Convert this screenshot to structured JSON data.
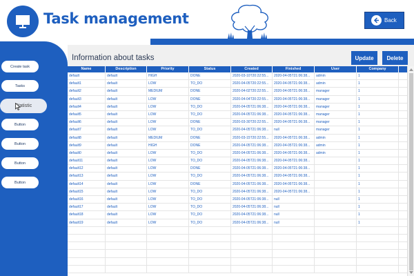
{
  "header": {
    "title": "Task management",
    "logo_icon": "presentation-board-icon",
    "back_label": "Back",
    "back_icon": "back-arrow-icon"
  },
  "sidebar": {
    "items": [
      {
        "label": "Create task"
      },
      {
        "label": "Tasks"
      },
      {
        "label": "Statistic",
        "active": true
      },
      {
        "label": "Button"
      },
      {
        "label": "Button"
      },
      {
        "label": "Button"
      },
      {
        "label": "Button"
      }
    ]
  },
  "main": {
    "title": "Information about tasks",
    "update_label": "Update",
    "delete_label": "Delete"
  },
  "table": {
    "columns": [
      "Name",
      "Description",
      "Priority",
      "Status",
      "Created",
      "Finished",
      "User",
      "Company"
    ],
    "rows": [
      [
        "default",
        "default",
        "HIGH",
        "DONE",
        "2020-03-10T20:22:55...",
        "2020-04-05T21:06:38...",
        "admin",
        "1"
      ],
      [
        "default1",
        "default",
        "LOW",
        "TO_DO",
        "2020-04-05T20:22:55...",
        "2020-04-05T21:06:38...",
        "admin",
        "1"
      ],
      [
        "default2",
        "default",
        "MEDIUM",
        "DONE",
        "2020-04-02T20:22:55...",
        "2020-04-05T21:06:38...",
        "manager",
        "1"
      ],
      [
        "default3",
        "default",
        "LOW",
        "DONE",
        "2020-04-04T20:22:55...",
        "2020-04-05T21:06:38...",
        "manager",
        "1"
      ],
      [
        "default4",
        "default",
        "LOW",
        "TO_DO",
        "2020-04-05T21:06:38...",
        "2020-04-05T21:06:38...",
        "manager",
        "1"
      ],
      [
        "default5",
        "default",
        "LOW",
        "TO_DO",
        "2020-04-05T21:06:38...",
        "2020-04-05T21:06:38...",
        "manager",
        "1"
      ],
      [
        "default6",
        "default",
        "LOW",
        "DONE",
        "2020-03-30T20:22:55...",
        "2020-04-05T21:06:38...",
        "manager",
        "1"
      ],
      [
        "default7",
        "default",
        "LOW",
        "TO_DO",
        "2020-04-05T21:06:38...",
        "null",
        "manager",
        "1"
      ],
      [
        "default8",
        "default",
        "MEDIUM",
        "DONE",
        "2020-03-15T20:22:55...",
        "2020-04-05T21:06:38...",
        "admin",
        "1"
      ],
      [
        "default9",
        "default",
        "HIGH",
        "DONE",
        "2020-04-05T21:06:38...",
        "2020-04-05T21:06:38...",
        "admin",
        "1"
      ],
      [
        "default0",
        "default",
        "LOW",
        "TO_DO",
        "2020-04-05T21:06:38...",
        "2020-04-05T21:06:38...",
        "admin",
        "1"
      ],
      [
        "default11",
        "default",
        "LOW",
        "TO_DO",
        "2020-04-05T21:06:38...",
        "2020-04-05T21:06:38...",
        "",
        "1"
      ],
      [
        "default12",
        "default",
        "LOW",
        "DONE",
        "2020-04-05T21:06:38...",
        "2020-04-05T21:06:38...",
        "",
        "1"
      ],
      [
        "default13",
        "default",
        "LOW",
        "TO_DO",
        "2020-04-05T21:06:38...",
        "2020-04-05T21:06:38...",
        "",
        "1"
      ],
      [
        "default14",
        "default",
        "LOW",
        "DONE",
        "2020-04-05T21:06:38...",
        "2020-04-05T21:06:38...",
        "",
        "1"
      ],
      [
        "default15",
        "default",
        "LOW",
        "TO_DO",
        "2020-04-05T21:06:38...",
        "2020-04-05T21:06:38...",
        "",
        "1"
      ],
      [
        "default16",
        "default",
        "LOW",
        "TO_DO",
        "2020-04-05T21:06:38...",
        "null",
        "",
        "1"
      ],
      [
        "default17",
        "default",
        "LOW",
        "TO_DO",
        "2020-04-05T21:06:38...",
        "null",
        "",
        "1"
      ],
      [
        "default18",
        "default",
        "LOW",
        "TO_DO",
        "2020-04-05T21:06:38...",
        "null",
        "",
        "1"
      ],
      [
        "default19",
        "default",
        "LOW",
        "TO_DO",
        "2020-04-05T21:06:38...",
        "null",
        "",
        "1"
      ]
    ]
  },
  "colors": {
    "brand": "#1e5fbf",
    "panel_background": "#f0f0f0",
    "text": "#1e5fbf"
  }
}
